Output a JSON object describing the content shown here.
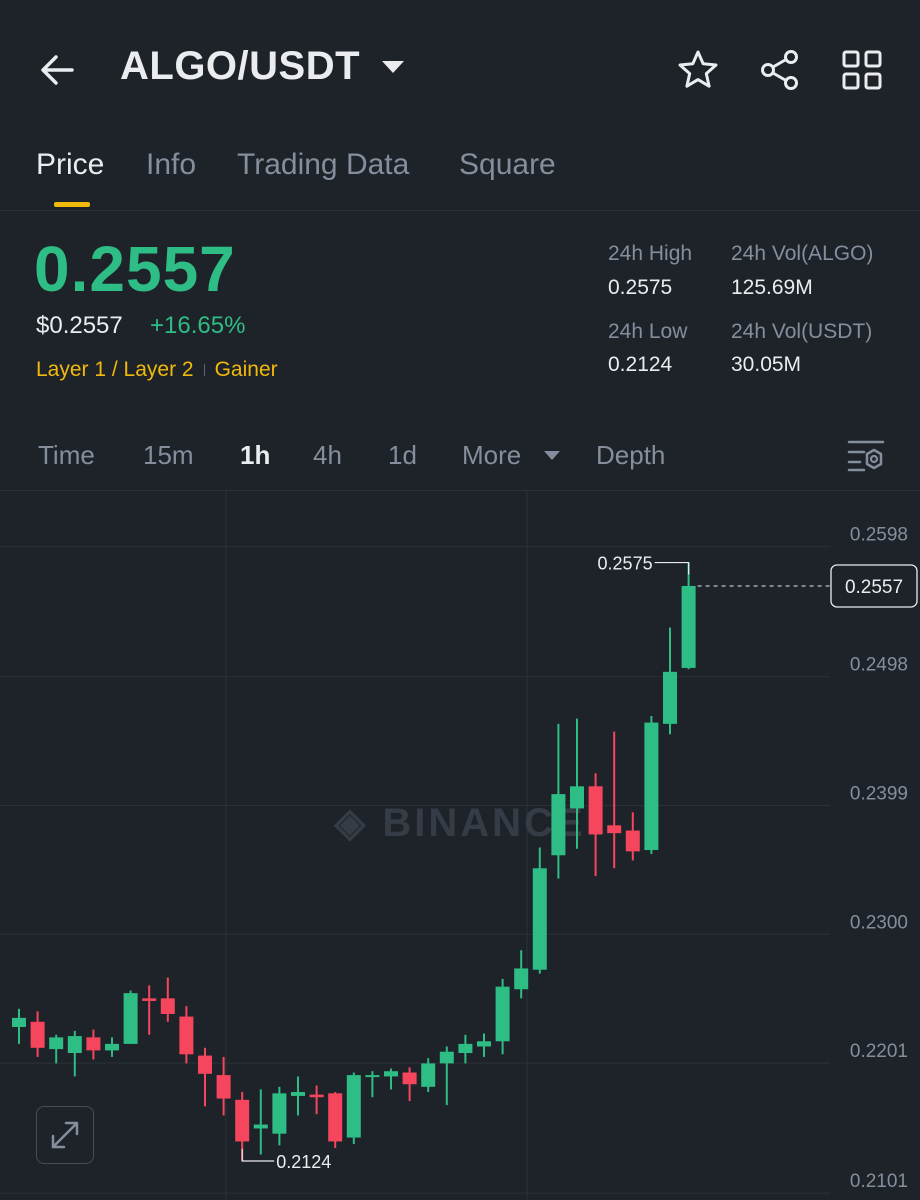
{
  "header": {
    "pair": "ALGO/USDT",
    "icons": [
      "back-arrow-icon",
      "chevron-down-icon",
      "star-icon",
      "share-icon",
      "grid-icon"
    ]
  },
  "tabs": [
    {
      "label": "Price",
      "active": true
    },
    {
      "label": "Info",
      "active": false
    },
    {
      "label": "Trading Data",
      "active": false
    },
    {
      "label": "Square",
      "active": false
    }
  ],
  "ticker": {
    "price": "0.2557",
    "usd_price": "$0.2557",
    "change": "+16.65%",
    "tag1": "Layer 1 / Layer 2",
    "tag2": "Gainer",
    "high_label": "24h High",
    "high_value": "0.2575",
    "low_label": "24h Low",
    "low_value": "0.2124",
    "vol_base_label": "24h Vol(ALGO)",
    "vol_base_value": "125.69M",
    "vol_quote_label": "24h Vol(USDT)",
    "vol_quote_value": "30.05M"
  },
  "timeframes": {
    "time": "Time",
    "m15": "15m",
    "h1": "1h",
    "h4": "4h",
    "d1": "1d",
    "more": "More",
    "depth": "Depth",
    "active": "1h"
  },
  "colors": {
    "up": "#2ebd85",
    "down": "#f6465d",
    "accent": "#f0b90b",
    "background": "#1e2329"
  },
  "chart_data": {
    "type": "candlestick",
    "watermark": "BINANCE",
    "y_ticks": [
      "0.2598",
      "0.2498",
      "0.2399",
      "0.2300",
      "0.2201",
      "0.2101"
    ],
    "ylim": [
      0.2085,
      0.263
    ],
    "last_price": "0.2557",
    "high_label": "0.2575",
    "low_label": "0.2124",
    "candles": [
      {
        "o": 0.2218,
        "h": 0.2232,
        "l": 0.2205,
        "c": 0.2225
      },
      {
        "o": 0.2222,
        "h": 0.223,
        "l": 0.2195,
        "c": 0.2202
      },
      {
        "o": 0.2201,
        "h": 0.2212,
        "l": 0.219,
        "c": 0.221
      },
      {
        "o": 0.2198,
        "h": 0.2215,
        "l": 0.218,
        "c": 0.2211
      },
      {
        "o": 0.221,
        "h": 0.2216,
        "l": 0.2193,
        "c": 0.22
      },
      {
        "o": 0.22,
        "h": 0.221,
        "l": 0.2195,
        "c": 0.2205
      },
      {
        "o": 0.2205,
        "h": 0.2246,
        "l": 0.2205,
        "c": 0.2244
      },
      {
        "o": 0.224,
        "h": 0.225,
        "l": 0.2212,
        "c": 0.2238
      },
      {
        "o": 0.224,
        "h": 0.2256,
        "l": 0.2222,
        "c": 0.2228
      },
      {
        "o": 0.2226,
        "h": 0.2234,
        "l": 0.219,
        "c": 0.2197
      },
      {
        "o": 0.2196,
        "h": 0.2202,
        "l": 0.2157,
        "c": 0.2182
      },
      {
        "o": 0.2181,
        "h": 0.2195,
        "l": 0.215,
        "c": 0.2163
      },
      {
        "o": 0.2162,
        "h": 0.2168,
        "l": 0.2115,
        "c": 0.213
      },
      {
        "o": 0.214,
        "h": 0.217,
        "l": 0.212,
        "c": 0.2143
      },
      {
        "o": 0.2136,
        "h": 0.2172,
        "l": 0.2127,
        "c": 0.2167
      },
      {
        "o": 0.2165,
        "h": 0.218,
        "l": 0.215,
        "c": 0.2168
      },
      {
        "o": 0.2166,
        "h": 0.2173,
        "l": 0.2151,
        "c": 0.2164
      },
      {
        "o": 0.2167,
        "h": 0.2168,
        "l": 0.2125,
        "c": 0.213
      },
      {
        "o": 0.2133,
        "h": 0.2183,
        "l": 0.2128,
        "c": 0.2181
      },
      {
        "o": 0.218,
        "h": 0.2184,
        "l": 0.2164,
        "c": 0.2181
      },
      {
        "o": 0.218,
        "h": 0.2186,
        "l": 0.217,
        "c": 0.2184
      },
      {
        "o": 0.2183,
        "h": 0.2187,
        "l": 0.2161,
        "c": 0.2174
      },
      {
        "o": 0.2172,
        "h": 0.2194,
        "l": 0.2168,
        "c": 0.219
      },
      {
        "o": 0.219,
        "h": 0.2203,
        "l": 0.2158,
        "c": 0.2199
      },
      {
        "o": 0.2198,
        "h": 0.2212,
        "l": 0.219,
        "c": 0.2205
      },
      {
        "o": 0.2203,
        "h": 0.2213,
        "l": 0.2195,
        "c": 0.2207
      },
      {
        "o": 0.2207,
        "h": 0.2255,
        "l": 0.2197,
        "c": 0.2249
      },
      {
        "o": 0.2247,
        "h": 0.2277,
        "l": 0.224,
        "c": 0.2263
      },
      {
        "o": 0.2262,
        "h": 0.2356,
        "l": 0.2259,
        "c": 0.234
      },
      {
        "o": 0.235,
        "h": 0.2451,
        "l": 0.2332,
        "c": 0.2397
      },
      {
        "o": 0.2386,
        "h": 0.2455,
        "l": 0.2355,
        "c": 0.2403
      },
      {
        "o": 0.2403,
        "h": 0.2413,
        "l": 0.2334,
        "c": 0.2366
      },
      {
        "o": 0.2373,
        "h": 0.2445,
        "l": 0.234,
        "c": 0.2367
      },
      {
        "o": 0.2369,
        "h": 0.2383,
        "l": 0.2346,
        "c": 0.2353
      },
      {
        "o": 0.2354,
        "h": 0.2457,
        "l": 0.2351,
        "c": 0.2452
      },
      {
        "o": 0.2451,
        "h": 0.2525,
        "l": 0.2443,
        "c": 0.2491
      },
      {
        "o": 0.2494,
        "h": 0.2575,
        "l": 0.2493,
        "c": 0.2557
      }
    ]
  }
}
